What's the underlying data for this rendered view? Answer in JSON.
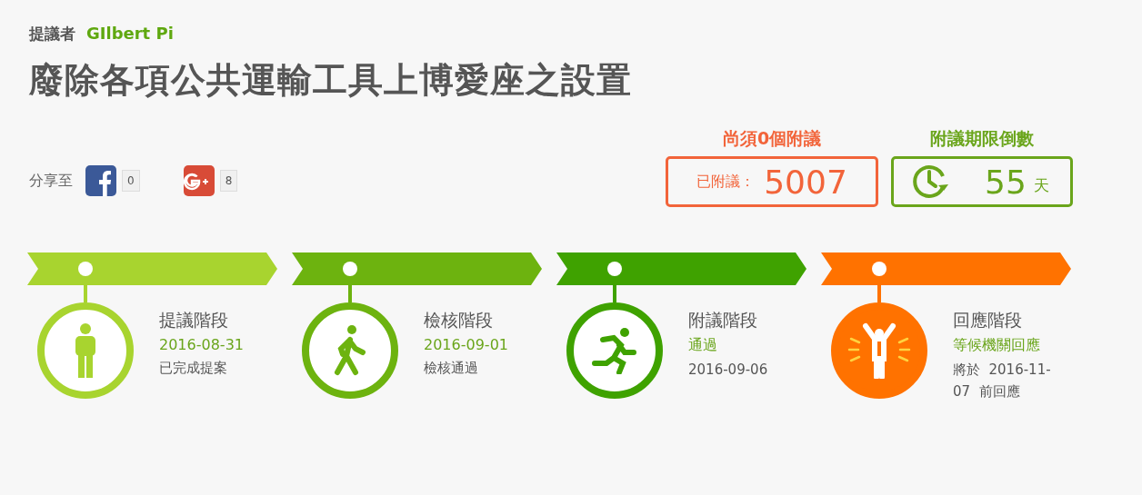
{
  "proposer": {
    "label": "提議者",
    "name": "GIlbert Pi"
  },
  "title": "廢除各項公共運輸工具上博愛座之設置",
  "share": {
    "label": "分享至",
    "buttons": [
      {
        "kind": "facebook",
        "count": "0"
      },
      {
        "kind": "googleplus",
        "count": "8"
      }
    ]
  },
  "signatures": {
    "heading": "尚須0個附議",
    "label": "已附議：",
    "count": "5007"
  },
  "countdown": {
    "heading": "附議期限倒數",
    "value": "55",
    "unit": "天"
  },
  "stages": [
    {
      "title": "提議階段",
      "status": "2016-08-31",
      "note": "已完成提案",
      "color": "#a8d42f",
      "kind": "standing",
      "filled": false
    },
    {
      "title": "檢核階段",
      "status": "2016-09-01",
      "note": "檢核通過",
      "color": "#6db30f",
      "kind": "walking",
      "filled": false
    },
    {
      "title": "附議階段",
      "status": "通過",
      "note": "2016-09-06",
      "color": "#3fa200",
      "kind": "running",
      "filled": false
    },
    {
      "title": "回應階段",
      "status": "等候機關回應",
      "note": "將於  2016-11-07  前回應",
      "color": "#ff7200",
      "kind": "cheering",
      "filled": true
    }
  ]
}
